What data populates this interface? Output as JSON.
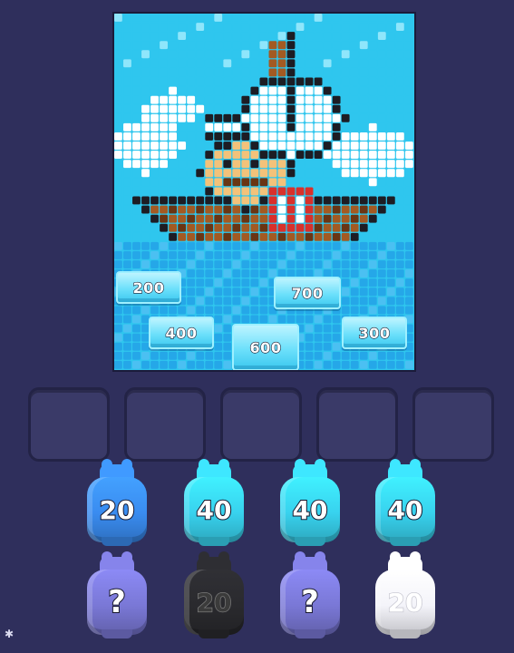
{
  "board": {
    "colors": {
      "sky": "#2fc6ee",
      "sky_light": "#8fe6fb",
      "cloud": "#ffffff",
      "black": "#1d1d24",
      "brown": "#a35a22",
      "dark_brown": "#6a3513",
      "skin": "#f3c27a",
      "sea": "#25a7e8",
      "accent_red": "#d9302b"
    },
    "blocks": [
      {
        "label": "200"
      },
      {
        "label": "700"
      },
      {
        "label": "400"
      },
      {
        "label": "600"
      },
      {
        "label": "300"
      }
    ]
  },
  "slots": [
    {},
    {},
    {},
    {},
    {}
  ],
  "bottles_row1": [
    {
      "label": "20",
      "color": "#3a8cf0"
    },
    {
      "label": "40",
      "color": "#38d2ee"
    },
    {
      "label": "40",
      "color": "#38d2ee"
    },
    {
      "label": "40",
      "color": "#38d2ee"
    }
  ],
  "bottles_row2": [
    {
      "label": "?",
      "color": "#7a78d6",
      "kind": "mystery"
    },
    {
      "label": "20",
      "color": "#2a2a2e",
      "kind": "dark"
    },
    {
      "label": "?",
      "color": "#7a78d6",
      "kind": "mystery"
    },
    {
      "label": "20",
      "color": "#f4f4fa",
      "kind": "white"
    }
  ]
}
